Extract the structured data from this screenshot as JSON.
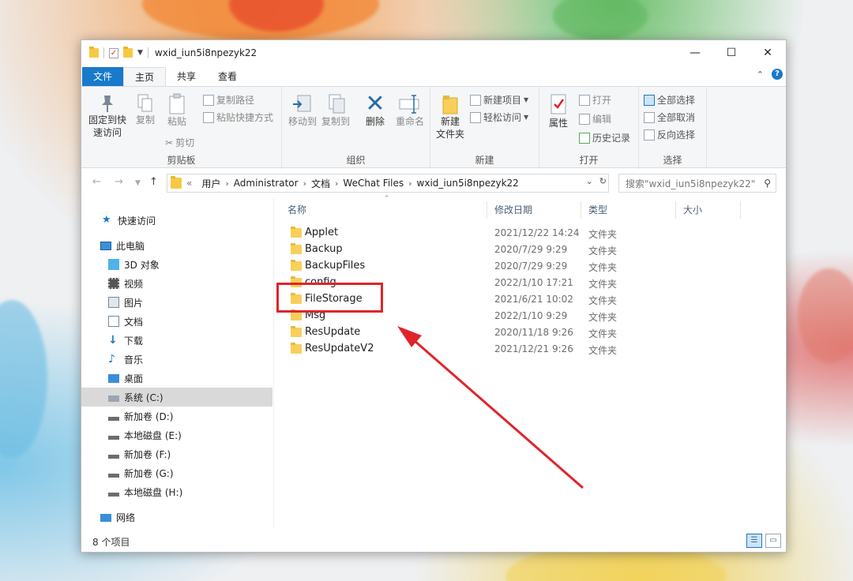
{
  "window": {
    "title": "wxid_iun5i8npezyk22"
  },
  "tabs": [
    "文件",
    "主页",
    "共享",
    "查看"
  ],
  "ribbon": {
    "clipboard": {
      "label": "剪贴板",
      "pin_label_1": "固定到快",
      "pin_label_2": "速访问",
      "copy": "复制",
      "paste": "粘贴",
      "copy_path": "复制路径",
      "paste_shortcut": "粘贴快捷方式",
      "cut": "剪切"
    },
    "organize": {
      "label": "组织",
      "move_to": "移动到",
      "copy_to": "复制到",
      "delete": "删除",
      "rename": "重命名"
    },
    "new": {
      "label": "新建",
      "new_folder_1": "新建",
      "new_folder_2": "文件夹",
      "new_item": "新建项目",
      "easy_access": "轻松访问"
    },
    "open": {
      "label": "打开",
      "properties": "属性",
      "open": "打开",
      "edit": "编辑",
      "history": "历史记录"
    },
    "select": {
      "label": "选择",
      "select_all": "全部选择",
      "select_none": "全部取消",
      "invert": "反向选择"
    }
  },
  "address": {
    "prefix": "«",
    "segments": [
      "用户",
      "Administrator",
      "文档",
      "WeChat Files",
      "wxid_iun5i8npezyk22"
    ]
  },
  "search": {
    "placeholder": "搜索\"wxid_iun5i8npezyk22\""
  },
  "nav": [
    {
      "label": "快速访问",
      "icon": "star-icon"
    },
    {
      "label": "此电脑",
      "icon": "computer-icon"
    },
    {
      "label": "3D 对象",
      "icon": "cube-icon"
    },
    {
      "label": "视频",
      "icon": "video-icon"
    },
    {
      "label": "图片",
      "icon": "picture-icon"
    },
    {
      "label": "文档",
      "icon": "document-icon"
    },
    {
      "label": "下载",
      "icon": "download-icon"
    },
    {
      "label": "音乐",
      "icon": "music-icon"
    },
    {
      "label": "桌面",
      "icon": "desktop-icon"
    },
    {
      "label": "系统 (C:)",
      "icon": "system-drive-icon"
    },
    {
      "label": "新加卷 (D:)",
      "icon": "drive-icon"
    },
    {
      "label": "本地磁盘 (E:)",
      "icon": "drive-icon"
    },
    {
      "label": "新加卷 (F:)",
      "icon": "drive-icon"
    },
    {
      "label": "新加卷 (G:)",
      "icon": "drive-icon"
    },
    {
      "label": "本地磁盘 (H:)",
      "icon": "drive-icon"
    },
    {
      "label": "网络",
      "icon": "network-icon"
    }
  ],
  "columns": {
    "name": "名称",
    "modified": "修改日期",
    "type": "类型",
    "size": "大小"
  },
  "files": [
    {
      "name": "Applet",
      "date": "2021/12/22 14:24",
      "type": "文件夹"
    },
    {
      "name": "Backup",
      "date": "2020/7/29 9:29",
      "type": "文件夹"
    },
    {
      "name": "BackupFiles",
      "date": "2020/7/29 9:29",
      "type": "文件夹"
    },
    {
      "name": "config",
      "date": "2022/1/10 17:21",
      "type": "文件夹"
    },
    {
      "name": "FileStorage",
      "date": "2021/6/21 10:02",
      "type": "文件夹"
    },
    {
      "name": "Msg",
      "date": "2022/1/10 9:29",
      "type": "文件夹"
    },
    {
      "name": "ResUpdate",
      "date": "2020/11/18 9:26",
      "type": "文件夹"
    },
    {
      "name": "ResUpdateV2",
      "date": "2021/12/21 9:26",
      "type": "文件夹"
    }
  ],
  "status": {
    "count": "8 个项目"
  },
  "colors": {
    "accent": "#1979ca",
    "highlight": "#e0242a",
    "folder": "#f8cf5a"
  }
}
